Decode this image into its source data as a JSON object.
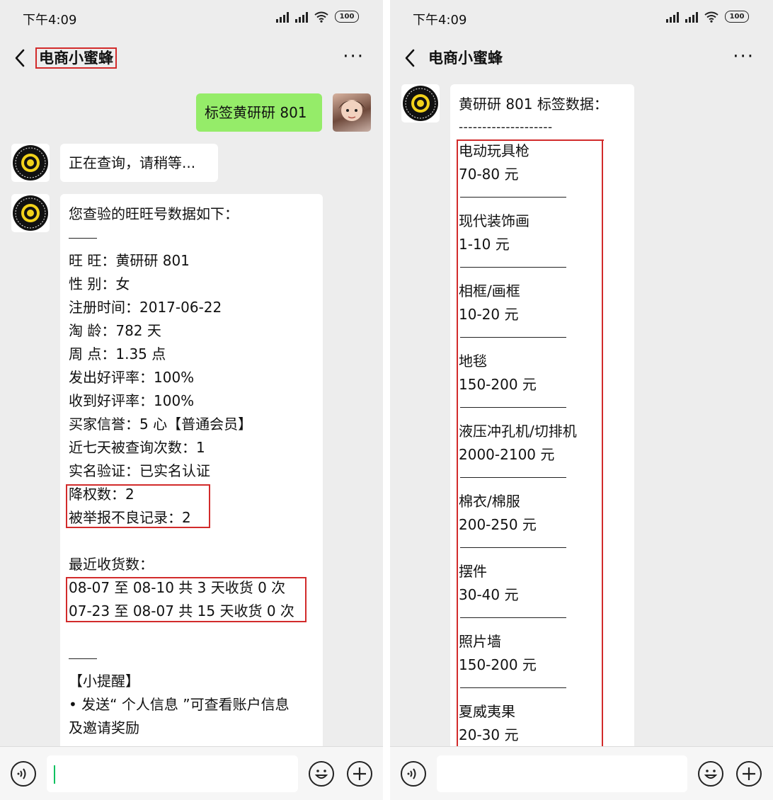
{
  "left": {
    "status": {
      "time": "下午4:09",
      "battery": "100"
    },
    "title": "电商小蜜蜂",
    "user_message": "标签黄研研 801",
    "bot_wait": "正在查询，请稍等...",
    "report": {
      "heading": "您查验的旺旺号数据如下：",
      "fields": [
        "旺 旺：黄研研 801",
        "性 别：女",
        "注册时间：2017-06-22",
        "淘 龄：782 天",
        "周 点：1.35 点",
        "发出好评率：100%",
        "收到好评率：100%",
        "买家信誉：5 心【普通会员】",
        "近七天被查询次数：1",
        "实名验证：已实名认证"
      ],
      "risk": [
        "降权数：2",
        "被举报不良记录：2"
      ],
      "recent_title": "最近收货数：",
      "recent": [
        "08-07 至 08-10 共 3 天收货 0 次",
        "07-23 至 08-07 共 15 天收货 0 次"
      ],
      "tips_title": "【小提醒】",
      "tips": [
        "• 发送“ 个人信息 ”可查看账户信息",
        "及邀请奖励"
      ]
    }
  },
  "right": {
    "status": {
      "time": "下午4:09",
      "battery": "100"
    },
    "title": "电商小蜜蜂",
    "tag_heading": "黄研研 801 标签数据：",
    "divider": "--------------------",
    "tags": [
      {
        "name": "电动玩具枪",
        "price": "70-80 元"
      },
      {
        "name": "现代装饰画",
        "price": "1-10 元"
      },
      {
        "name": "相框/画框",
        "price": "10-20 元"
      },
      {
        "name": "地毯",
        "price": "150-200 元"
      },
      {
        "name": "液压冲孔机/切排机",
        "price": "2000-2100 元"
      },
      {
        "name": "棉衣/棉服",
        "price": "200-250 元"
      },
      {
        "name": "摆件",
        "price": "30-40 元"
      },
      {
        "name": "照片墙",
        "price": "150-200 元"
      },
      {
        "name": "夏威夷果",
        "price": "20-30 元"
      }
    ]
  },
  "colors": {
    "accent_red": "#d22b2b",
    "chat_bg": "#ededed",
    "user_bubble": "#95ec69",
    "cursor": "#07c160"
  }
}
